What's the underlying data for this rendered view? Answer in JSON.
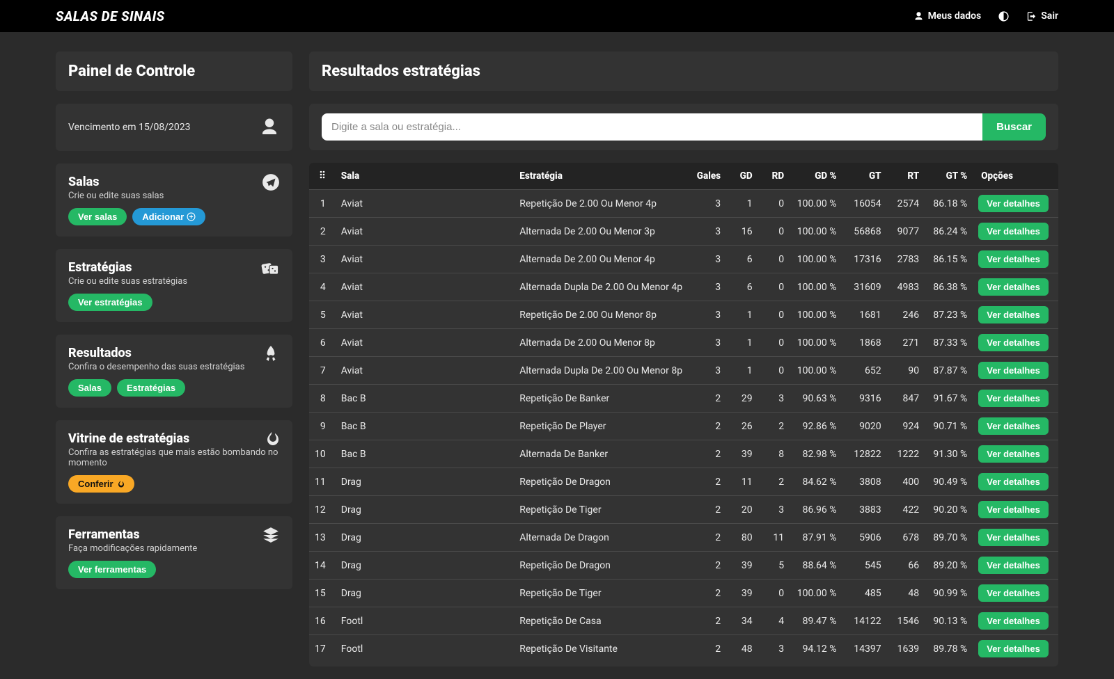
{
  "header": {
    "brand": "SALAS DE SINAIS",
    "my_data": "Meus dados",
    "logout": "Sair"
  },
  "sidebar": {
    "panel_title": "Painel de Controle",
    "vencimento": "Vencimento em 15/08/2023",
    "cards": {
      "salas": {
        "title": "Salas",
        "subtitle": "Crie ou edite suas salas",
        "btn_ver": "Ver salas",
        "btn_add": "Adicionar"
      },
      "estrategias": {
        "title": "Estratégias",
        "subtitle": "Crie ou edite suas estratégias",
        "btn_ver": "Ver estratégias"
      },
      "resultados": {
        "title": "Resultados",
        "subtitle": "Confira o desempenho das suas estratégias",
        "btn_salas": "Salas",
        "btn_estr": "Estratégias"
      },
      "vitrine": {
        "title": "Vitrine de estratégias",
        "subtitle": "Confira as estratégias que mais estão bombando no momento",
        "btn": "Conferir"
      },
      "ferramentas": {
        "title": "Ferramentas",
        "subtitle": "Faça modificações rapidamente",
        "btn": "Ver ferramentas"
      }
    }
  },
  "main": {
    "title": "Resultados estratégias",
    "search": {
      "placeholder": "Digite a sala ou estratégia...",
      "button": "Buscar"
    },
    "columns": {
      "sala": "Sala",
      "estrategia": "Estratégia",
      "gales": "Gales",
      "gd": "GD",
      "rd": "RD",
      "gdp": "GD %",
      "gt": "GT",
      "rt": "RT",
      "gtp": "GT %",
      "opcoes": "Opções"
    },
    "detail_label": "Ver detalhes",
    "rows": [
      {
        "sala": "Aviat",
        "estr": "Repetição De 2.00 Ou Menor 4p",
        "gales": "3",
        "gd": "1",
        "rd": "0",
        "gdp": "100.00 %",
        "gt": "16054",
        "rt": "2574",
        "gtp": "86.18 %"
      },
      {
        "sala": "Aviat",
        "estr": "Alternada De 2.00 Ou Menor 3p",
        "gales": "3",
        "gd": "16",
        "rd": "0",
        "gdp": "100.00 %",
        "gt": "56868",
        "rt": "9077",
        "gtp": "86.24 %"
      },
      {
        "sala": "Aviat",
        "estr": "Alternada De 2.00 Ou Menor 4p",
        "gales": "3",
        "gd": "6",
        "rd": "0",
        "gdp": "100.00 %",
        "gt": "17316",
        "rt": "2783",
        "gtp": "86.15 %"
      },
      {
        "sala": "Aviat",
        "estr": "Alternada Dupla De 2.00 Ou Menor 4p",
        "gales": "3",
        "gd": "6",
        "rd": "0",
        "gdp": "100.00 %",
        "gt": "31609",
        "rt": "4983",
        "gtp": "86.38 %"
      },
      {
        "sala": "Aviat",
        "estr": "Repetição De 2.00 Ou Menor 8p",
        "gales": "3",
        "gd": "1",
        "rd": "0",
        "gdp": "100.00 %",
        "gt": "1681",
        "rt": "246",
        "gtp": "87.23 %"
      },
      {
        "sala": "Aviat",
        "estr": "Alternada De 2.00 Ou Menor 8p",
        "gales": "3",
        "gd": "1",
        "rd": "0",
        "gdp": "100.00 %",
        "gt": "1868",
        "rt": "271",
        "gtp": "87.33 %"
      },
      {
        "sala": "Aviat",
        "estr": "Alternada Dupla De 2.00 Ou Menor 8p",
        "gales": "3",
        "gd": "1",
        "rd": "0",
        "gdp": "100.00 %",
        "gt": "652",
        "rt": "90",
        "gtp": "87.87 %"
      },
      {
        "sala": "Bac B",
        "estr": "Repetição De Banker",
        "gales": "2",
        "gd": "29",
        "rd": "3",
        "gdp": "90.63 %",
        "gt": "9316",
        "rt": "847",
        "gtp": "91.67 %"
      },
      {
        "sala": "Bac B",
        "estr": "Repetição De Player",
        "gales": "2",
        "gd": "26",
        "rd": "2",
        "gdp": "92.86 %",
        "gt": "9020",
        "rt": "924",
        "gtp": "90.71 %"
      },
      {
        "sala": "Bac B",
        "estr": "Alternada De Banker",
        "gales": "2",
        "gd": "39",
        "rd": "8",
        "gdp": "82.98 %",
        "gt": "12822",
        "rt": "1222",
        "gtp": "91.30 %"
      },
      {
        "sala": "Drag",
        "estr": "Repetição De Dragon",
        "gales": "2",
        "gd": "11",
        "rd": "2",
        "gdp": "84.62 %",
        "gt": "3808",
        "rt": "400",
        "gtp": "90.49 %"
      },
      {
        "sala": "Drag",
        "estr": "Repetição De Tiger",
        "gales": "2",
        "gd": "20",
        "rd": "3",
        "gdp": "86.96 %",
        "gt": "3883",
        "rt": "422",
        "gtp": "90.20 %"
      },
      {
        "sala": "Drag",
        "estr": "Alternada De Dragon",
        "gales": "2",
        "gd": "80",
        "rd": "11",
        "gdp": "87.91 %",
        "gt": "5906",
        "rt": "678",
        "gtp": "89.70 %"
      },
      {
        "sala": "Drag",
        "estr": "Repetição De Dragon",
        "gales": "2",
        "gd": "39",
        "rd": "5",
        "gdp": "88.64 %",
        "gt": "545",
        "rt": "66",
        "gtp": "89.20 %"
      },
      {
        "sala": "Drag",
        "estr": "Repetição De Tiger",
        "gales": "2",
        "gd": "39",
        "rd": "0",
        "gdp": "100.00 %",
        "gt": "485",
        "rt": "48",
        "gtp": "90.99 %"
      },
      {
        "sala": "Footl",
        "estr": "Repetição De Casa",
        "gales": "2",
        "gd": "34",
        "rd": "4",
        "gdp": "89.47 %",
        "gt": "14122",
        "rt": "1546",
        "gtp": "90.13 %"
      },
      {
        "sala": "Footl",
        "estr": "Repetição De Visitante",
        "gales": "2",
        "gd": "48",
        "rd": "3",
        "gdp": "94.12 %",
        "gt": "14397",
        "rt": "1639",
        "gtp": "89.78 %"
      }
    ]
  }
}
